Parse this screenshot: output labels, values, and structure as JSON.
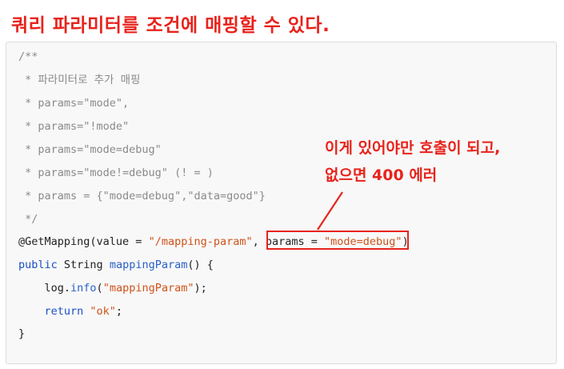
{
  "heading": "쿼리 파라미터를 조건에 매핑할 수 있다.",
  "code": {
    "c1": "/**",
    "c2": " * 파라미터로 추가 매핑",
    "c3": " * params=\"mode\",",
    "c4": " * params=\"!mode\"",
    "c5": " * params=\"mode=debug\"",
    "c6": " * params=\"mode!=debug\" (! = )",
    "c7": " * params = {\"mode=debug\",\"data=good\"}",
    "c8": " */",
    "l9_annot": "@GetMapping(value = ",
    "l9_str1": "\"/mapping-param\"",
    "l9_mid": ", params = ",
    "l9_str2": "\"mode=debug\"",
    "l9_end": ")",
    "l10_kw": "public",
    "l10_type": " String ",
    "l10_fn": "mappingParam",
    "l10_end": "() {",
    "l11_obj": "    log.",
    "l11_fn": "info",
    "l11_open": "(",
    "l11_str": "\"mappingParam\"",
    "l11_end": ");",
    "l12_kw": "    return ",
    "l12_str": "\"ok\"",
    "l12_end": ";",
    "l13": "}"
  },
  "annotation": {
    "line1": "이게 있어야만 호출이 되고,",
    "line2": "없으면 400 에러"
  },
  "colors": {
    "accent_red": "#e8231c",
    "string": "#d0521a",
    "keyword": "#1a4fc4",
    "comment": "#8a8a8a"
  }
}
